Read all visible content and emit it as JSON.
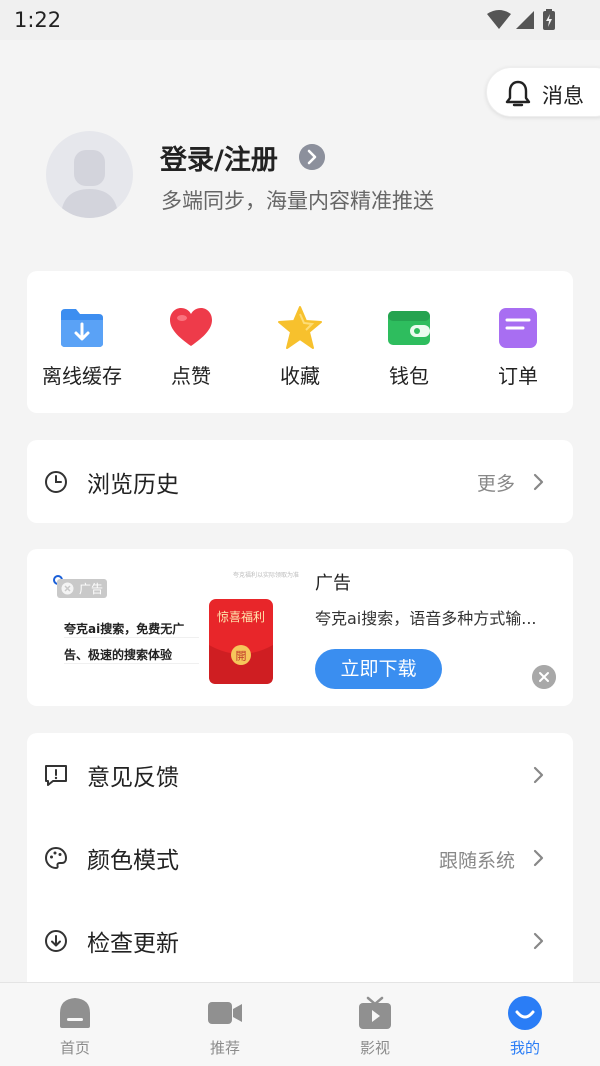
{
  "status_bar": {
    "time": "1:22"
  },
  "header": {
    "message_button": {
      "label": "消息",
      "icon": "bell-icon"
    },
    "login": {
      "title": "登录/注册",
      "subtitle": "多端同步，海量内容精准推送"
    }
  },
  "quick_actions": [
    {
      "label": "离线缓存",
      "icon": "download-folder-icon",
      "color": "#3d8ef0"
    },
    {
      "label": "点赞",
      "icon": "heart-icon",
      "color": "#ee3b4a"
    },
    {
      "label": "收藏",
      "icon": "star-icon",
      "color": "#f7c12d"
    },
    {
      "label": "钱包",
      "icon": "wallet-icon",
      "color": "#2ebd5e"
    },
    {
      "label": "订单",
      "icon": "order-icon",
      "color": "#a86ef2"
    }
  ],
  "history": {
    "label": "浏览历史",
    "more": "更多"
  },
  "ad": {
    "badge": "广告",
    "image_small_text": "夸克福利以实际领取为准",
    "image_line1": "夸克ai搜索，免费无广",
    "image_line2": "告、极速的搜索体验",
    "packet_text": "惊喜福利",
    "packet_open": "開",
    "tag": "广告",
    "description": "夸克ai搜索，语音多种方式输...",
    "cta": "立即下载"
  },
  "settings": [
    {
      "label": "意见反馈",
      "value": "",
      "icon": "feedback-icon"
    },
    {
      "label": "颜色模式",
      "value": "跟随系统",
      "icon": "palette-icon"
    },
    {
      "label": "检查更新",
      "value": "",
      "icon": "update-icon"
    }
  ],
  "tabs": [
    {
      "label": "首页",
      "icon": "home-icon",
      "active": false
    },
    {
      "label": "推荐",
      "icon": "video-camera-icon",
      "active": false
    },
    {
      "label": "影视",
      "icon": "tv-icon",
      "active": false
    },
    {
      "label": "我的",
      "icon": "smile-icon",
      "active": true
    }
  ],
  "colors": {
    "accent": "#2a7df6",
    "cta": "#3a8ef0",
    "background": "#f4f4f4"
  }
}
